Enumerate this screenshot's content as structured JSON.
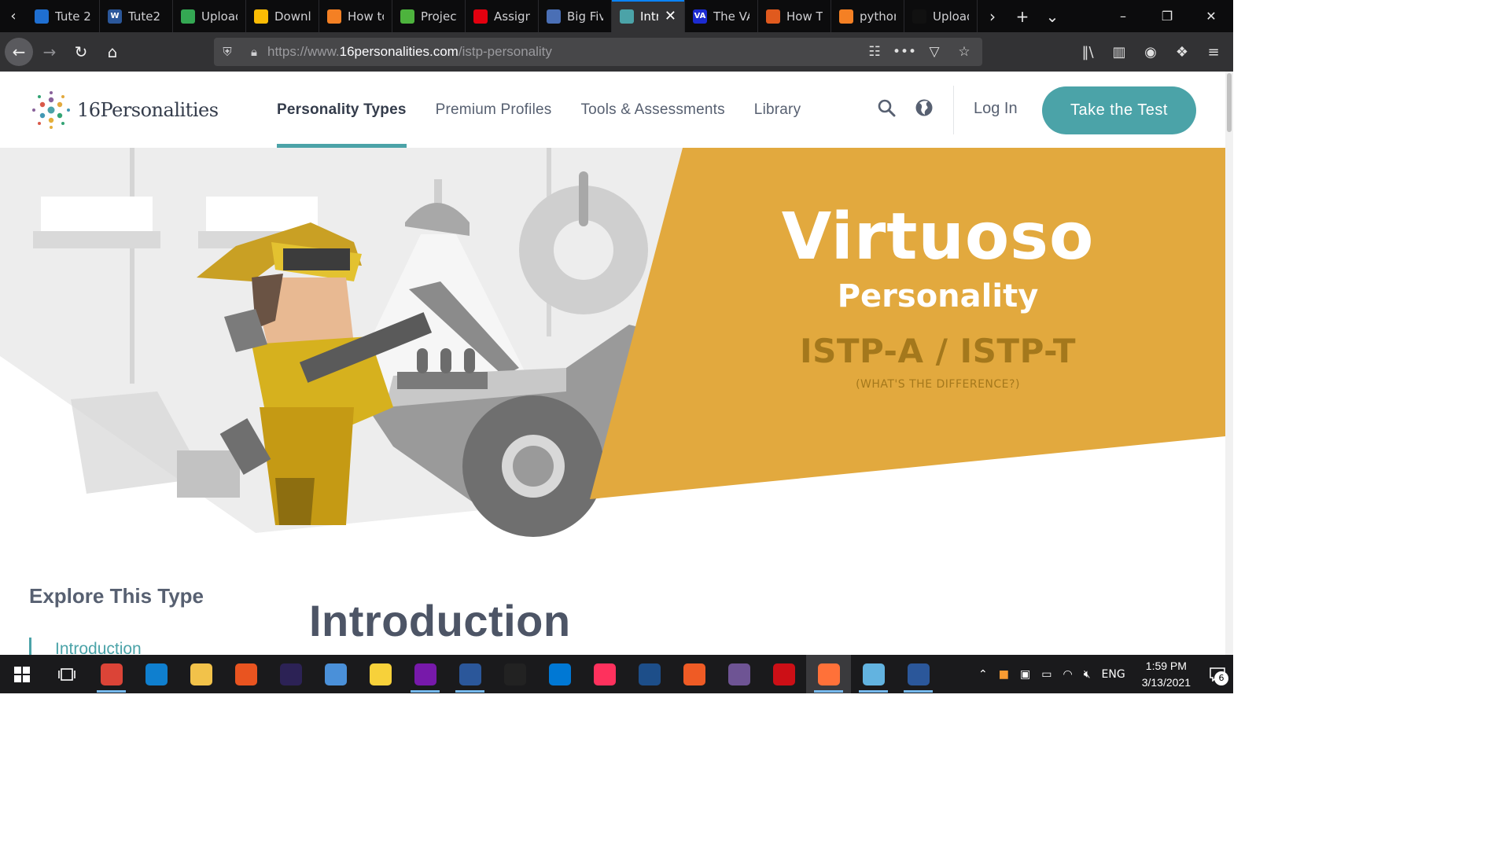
{
  "browser": {
    "tabs": [
      {
        "label": "Tute 2",
        "fav_color": "#1f6fd1",
        "fav_text": "",
        "active": false
      },
      {
        "label": "Tute2",
        "fav_color": "#2b579a",
        "fav_text": "W",
        "active": false
      },
      {
        "label": "Upload",
        "fav_color": "#34a853",
        "fav_text": "",
        "active": false
      },
      {
        "label": "Downl",
        "fav_color": "#fbbc04",
        "fav_text": "",
        "active": false
      },
      {
        "label": "How to",
        "fav_color": "#f48024",
        "fav_text": "",
        "active": false
      },
      {
        "label": "Project",
        "fav_color": "#4db33d",
        "fav_text": "",
        "active": false
      },
      {
        "label": "Assign",
        "fav_color": "#e3000f",
        "fav_text": "",
        "active": false
      },
      {
        "label": "Big Fiv",
        "fav_color": "#4a6fb5",
        "fav_text": "",
        "active": false
      },
      {
        "label": "Intr",
        "fav_color": "#4ba3a8",
        "fav_text": "",
        "active": true
      },
      {
        "label": "The VA",
        "fav_color": "#1c2bd1",
        "fav_text": "VA",
        "active": false
      },
      {
        "label": "How T",
        "fav_color": "#e05a1e",
        "fav_text": "",
        "active": false
      },
      {
        "label": "python",
        "fav_color": "#f48024",
        "fav_text": "",
        "active": false
      },
      {
        "label": "Upload",
        "fav_color": "#111111",
        "fav_text": "",
        "active": false
      }
    ],
    "url_prefix": "https://www.",
    "url_domain": "16personalities.com",
    "url_path": "/istp-personality"
  },
  "site": {
    "logo_text": "16Personalities",
    "nav": [
      {
        "label": "Personality Types",
        "active": true
      },
      {
        "label": "Premium Profiles",
        "active": false
      },
      {
        "label": "Tools & Assessments",
        "active": false
      },
      {
        "label": "Library",
        "active": false
      }
    ],
    "login": "Log In",
    "cta": "Take the Test"
  },
  "hero": {
    "title": "Virtuoso",
    "subtitle": "Personality",
    "code": "ISTP-A / ISTP-T",
    "difference_link": "(WHAT'S THE DIFFERENCE?)",
    "colors": {
      "accent": "#e2a93e",
      "teal": "#4ba3a8",
      "code": "#a4781c"
    }
  },
  "content": {
    "explore_heading": "Explore This Type",
    "toc_first": "Introduction",
    "section_title": "Introduction"
  },
  "taskbar": {
    "apps": [
      {
        "name": "chrome",
        "color": "#db4437",
        "open": true
      },
      {
        "name": "edge",
        "color": "#0f7fcf",
        "open": false
      },
      {
        "name": "file-explorer",
        "color": "#f2c24a",
        "open": false
      },
      {
        "name": "ubuntu",
        "color": "#e95420",
        "open": false
      },
      {
        "name": "eclipse",
        "color": "#2c2255",
        "open": false
      },
      {
        "name": "database",
        "color": "#4a90d9",
        "open": false
      },
      {
        "name": "sticky-notes",
        "color": "#f7d13a",
        "open": false
      },
      {
        "name": "onenote",
        "color": "#7719aa",
        "open": true
      },
      {
        "name": "word",
        "color": "#2b579a",
        "open": true
      },
      {
        "name": "unity",
        "color": "#222222",
        "open": false
      },
      {
        "name": "vscode",
        "color": "#0078d4",
        "open": false
      },
      {
        "name": "intellij",
        "color": "#fe315d",
        "open": false
      },
      {
        "name": "virtualbox",
        "color": "#1d4e89",
        "open": false
      },
      {
        "name": "postman",
        "color": "#ef5b25",
        "open": false
      },
      {
        "name": "github",
        "color": "#6e5494",
        "open": false
      },
      {
        "name": "opera",
        "color": "#cc0f16",
        "open": false
      },
      {
        "name": "firefox",
        "color": "#ff7139",
        "open": true,
        "focused": true
      },
      {
        "name": "notepad",
        "color": "#62b3e0",
        "open": true
      },
      {
        "name": "word-2",
        "color": "#2b579a",
        "open": true
      }
    ],
    "language": "ENG",
    "time": "1:59 PM",
    "date": "3/13/2021",
    "notifications": "6"
  }
}
